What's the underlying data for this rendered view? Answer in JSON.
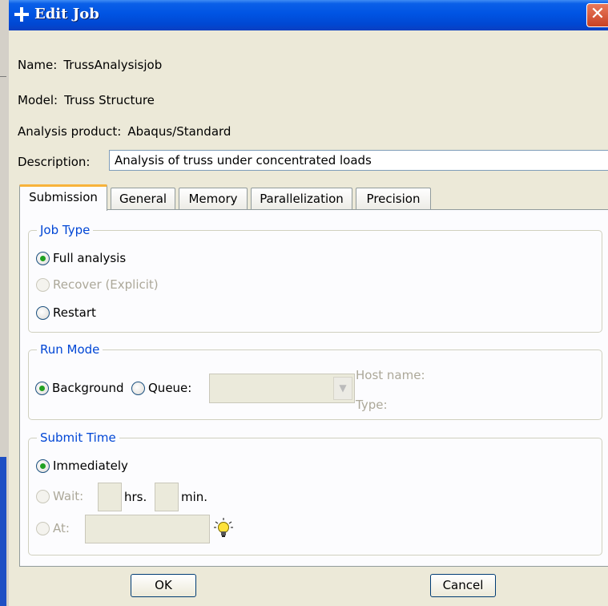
{
  "window": {
    "title": "Edit Job",
    "close_label": "✕"
  },
  "job": {
    "name_label": "Name:",
    "name_value": "TrussAnalysisjob",
    "model_label": "Model:",
    "model_value": "Truss Structure",
    "product_label": "Analysis product:",
    "product_value": "Abaqus/Standard",
    "description_label": "Description:",
    "description_value": "Analysis of truss under concentrated loads"
  },
  "tabs": [
    {
      "label": "Submission",
      "active": true
    },
    {
      "label": "General",
      "active": false
    },
    {
      "label": "Memory",
      "active": false
    },
    {
      "label": "Parallelization",
      "active": false
    },
    {
      "label": "Precision",
      "active": false
    }
  ],
  "job_type": {
    "legend": "Job Type",
    "options": [
      {
        "label": "Full analysis",
        "selected": true,
        "enabled": true
      },
      {
        "label": "Recover (Explicit)",
        "selected": false,
        "enabled": false
      },
      {
        "label": "Restart",
        "selected": false,
        "enabled": true
      }
    ]
  },
  "run_mode": {
    "legend": "Run Mode",
    "background_label": "Background",
    "background_selected": true,
    "queue_label": "Queue:",
    "queue_value": "",
    "host_name_label": "Host name:",
    "type_label": "Type:"
  },
  "submit_time": {
    "legend": "Submit Time",
    "immediately_label": "Immediately",
    "immediately_selected": true,
    "wait_label": "Wait:",
    "hrs_label": "hrs.",
    "min_label": "min.",
    "at_label": "At:",
    "hrs_value": "",
    "min_value": "",
    "at_value": ""
  },
  "buttons": {
    "ok_label": "OK",
    "cancel_label": "Cancel"
  },
  "icons": {
    "window": "plus-icon",
    "close": "close-icon",
    "dropdown": "chevron-down-icon",
    "hint": "lightbulb-icon"
  },
  "colors": {
    "titlebar": "#0054e3",
    "legend_text": "#0046d5",
    "active_tab_accent": "#f8b33a",
    "radio_checked": "#21a121",
    "close_button": "#c84224"
  }
}
